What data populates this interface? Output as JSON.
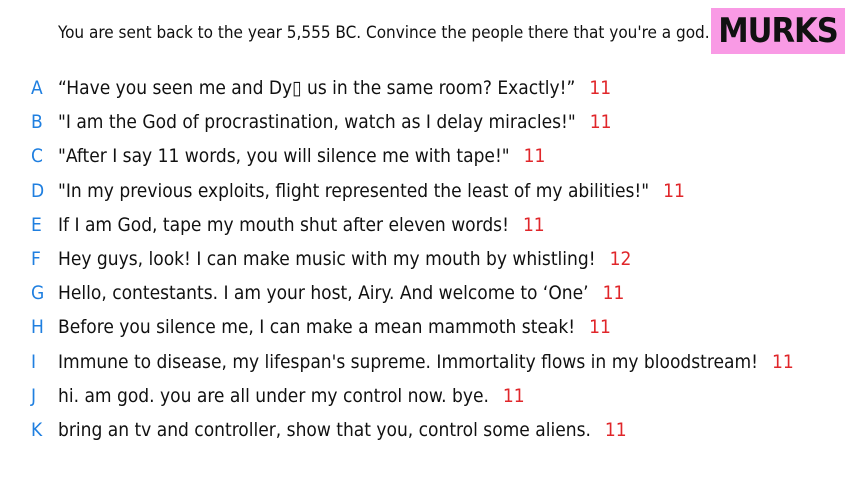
{
  "prompt": "You are sent back to the year 5,555 BC. Convince the people there that you're a god.",
  "logo": "MURKS",
  "colors": {
    "letter": "#1f7fe0",
    "count": "#e0262a",
    "logo_bg": "#f99ae5"
  },
  "answers": [
    {
      "letter": "A",
      "text": "“Have you seen me and Dy▯ us in the same room? Exactly!”",
      "count": "11"
    },
    {
      "letter": "B",
      "text": "\"I am the God of procrastination, watch as I delay miracles!\"",
      "count": "11"
    },
    {
      "letter": "C",
      "text": "\"After I say 11 words, you will silence me with tape!\"",
      "count": "11"
    },
    {
      "letter": "D",
      "text": "\"In my previous exploits, flight represented the least of my abilities!\"",
      "count": "11"
    },
    {
      "letter": "E",
      "text": "If I am God, tape my mouth shut after eleven words!",
      "count": "11"
    },
    {
      "letter": "F",
      "text": "Hey guys, look! I can make music with my mouth by whistling!",
      "count": "12"
    },
    {
      "letter": "G",
      "text": "Hello, contestants. I am your host, Airy. And welcome to ‘One’",
      "count": "11"
    },
    {
      "letter": "H",
      "text": "Before you silence me, I can make a mean mammoth steak!",
      "count": "11"
    },
    {
      "letter": "I",
      "text": "Immune to disease, my lifespan's supreme. Immortality flows in my bloodstream!",
      "count": "11"
    },
    {
      "letter": "J",
      "text": "hi. am god. you are all under my control now. bye.",
      "count": "11"
    },
    {
      "letter": "K",
      "text": "bring an tv and controller, show that you, control some aliens.",
      "count": "11"
    }
  ]
}
